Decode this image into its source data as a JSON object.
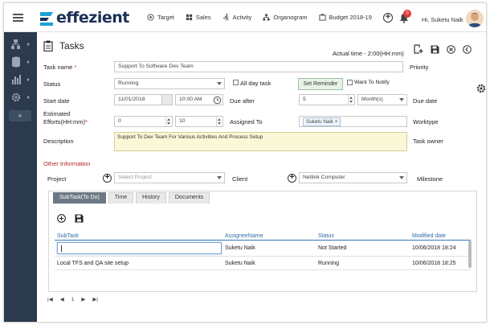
{
  "app": {
    "logo_text": "effezient",
    "nav": [
      {
        "label": "Target",
        "icon": "target-icon"
      },
      {
        "label": "Sales",
        "icon": "grid-icon"
      },
      {
        "label": "Activity",
        "icon": "runner-icon"
      },
      {
        "label": "Organogram",
        "icon": "org-icon"
      },
      {
        "label": "Budget 2018-19",
        "icon": "budget-icon"
      }
    ],
    "notification_count": "0",
    "user_greeting": "Hi, Suketu Naik"
  },
  "page": {
    "title": "Tasks",
    "actual_time": "Actual time - 2:00(HH:mm)"
  },
  "form": {
    "task_name_label": "Task name",
    "task_name_required": "*",
    "task_name_value": "Support To Software Dev Team",
    "priority_label": "Priority",
    "status_label": "Status",
    "status_value": "Running",
    "all_day_label": "All day task",
    "set_reminder_label": "Set Reminder",
    "want_notify_label": "Want To Notify",
    "start_date_label": "Start date",
    "start_date_value": "11/01/2018",
    "start_time_value": "10:00 AM",
    "due_after_label": "Due after",
    "due_after_value": "5",
    "due_after_unit": "Month(s)",
    "due_date_label": "Due date",
    "effort_label_1": "Estimated",
    "effort_label_2": "Efforts(HH:mm)",
    "effort_required": "*",
    "effort_hours": "0",
    "effort_minutes": "10",
    "assigned_to_label": "Assigned To",
    "assigned_tag": "Suketu Naik",
    "worktype_label": "Worktype",
    "description_label": "Description",
    "description_value": "Support To Dev Team For Various Activities And Process Setup",
    "task_owner_label": "Task owner",
    "other_info_label": "Other Information",
    "project_label": "Project",
    "project_placeholder": "Select Project",
    "client_label": "Client",
    "client_value": "Netlink Computer",
    "milestone_label": "Milestone"
  },
  "tabs": [
    "SubTask(To Do)",
    "Time",
    "History",
    "Documents"
  ],
  "subtask_table": {
    "columns": [
      "SubTask",
      "AssigneeName",
      "Status",
      "Modified date"
    ],
    "rows": [
      [
        "",
        "Suketu Naik",
        "Not Started",
        "10/06/2018 18:24"
      ],
      [
        "Local TFS and QA site setup",
        "Suketu Naik",
        "Running",
        "10/06/2018 18:25"
      ]
    ]
  },
  "pager": {
    "current": "1"
  },
  "colors": {
    "sidebar": "#2b3a4d",
    "accent_red": "#d9232d",
    "link_blue": "#2e6aa8",
    "active_tab": "#6d7885"
  }
}
